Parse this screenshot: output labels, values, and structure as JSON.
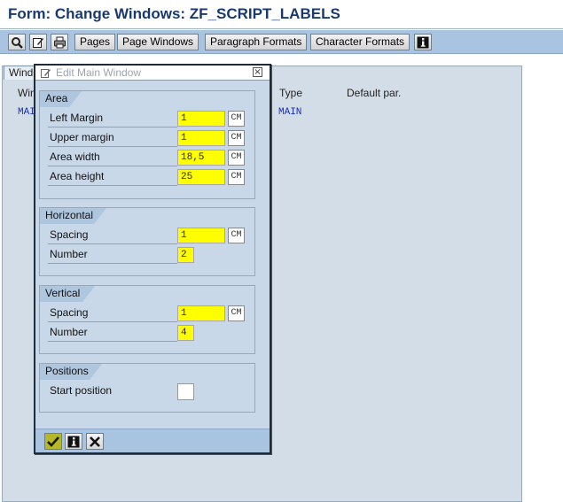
{
  "window_title": "Form: Change Windows: ZF_SCRIPT_LABELS",
  "toolbar": {
    "icons": [
      "find-icon",
      "edit-icon",
      "print-icon"
    ],
    "buttons": [
      "Pages",
      "Page Windows",
      "Paragraph Formats",
      "Character Formats"
    ],
    "info_icon": "info-icon"
  },
  "background": {
    "tab_label": "Windo",
    "col_window": "Win",
    "col_type": "Type",
    "col_default": "Default par.",
    "row_window": "MAI",
    "row_type": "MAIN"
  },
  "dialog": {
    "title": "Edit Main Window",
    "area": {
      "label": "Area",
      "left_margin_label": "Left Margin",
      "left_margin_value": "1",
      "left_margin_unit": "CM",
      "upper_margin_label": "Upper margin",
      "upper_margin_value": "1",
      "upper_margin_unit": "CM",
      "width_label": "Area width",
      "width_value": "18,5",
      "width_unit": "CM",
      "height_label": "Area height",
      "height_value": "25",
      "height_unit": "CM"
    },
    "horizontal": {
      "label": "Horizontal",
      "spacing_label": "Spacing",
      "spacing_value": "1",
      "spacing_unit": "CM",
      "number_label": "Number",
      "number_value": "2"
    },
    "vertical": {
      "label": "Vertical",
      "spacing_label": "Spacing",
      "spacing_value": "1",
      "spacing_unit": "CM",
      "number_label": "Number",
      "number_value": "4"
    },
    "positions": {
      "label": "Positions",
      "start_label": "Start position",
      "start_value": ""
    },
    "footer_icons": [
      "confirm-icon",
      "info-icon",
      "cancel-icon"
    ]
  },
  "colors": {
    "title_text": "#1a3a6e",
    "toolbar_bg": "#a8c4e0",
    "required_field": "#ffff00",
    "confirm_bg": "#b5b82a"
  }
}
